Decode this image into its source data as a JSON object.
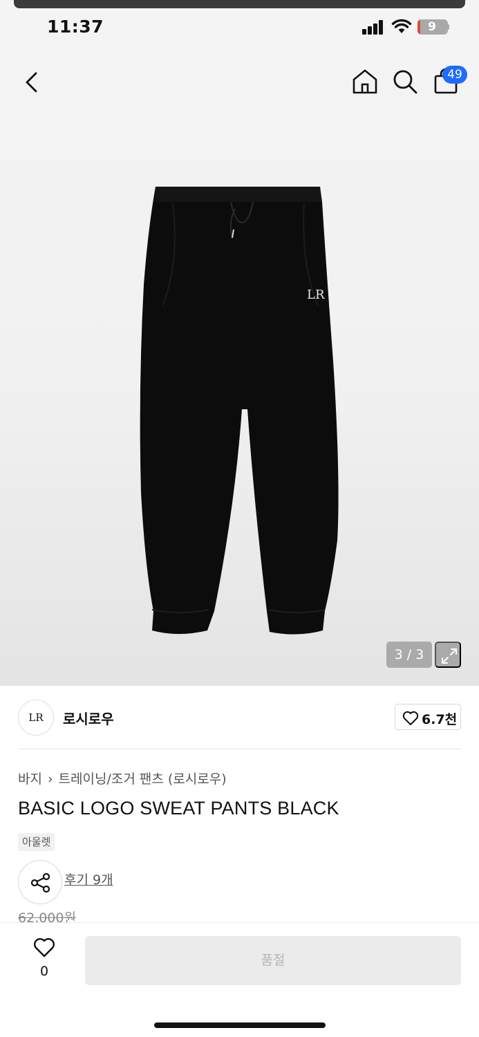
{
  "status_bar": {
    "time": "11:37",
    "battery": "9",
    "battery_level": 0.09
  },
  "nav": {
    "cart_count": "49"
  },
  "gallery": {
    "counter": "3 / 3",
    "logo_mark": "LR"
  },
  "brand": {
    "name": "로시로우",
    "logo": "LR",
    "likes": "6.7천"
  },
  "breadcrumb": {
    "category": "바지",
    "subcategory": "트레이닝/조거 팬츠 (로시로우)"
  },
  "product": {
    "title": "BASIC LOGO SWEAT PANTS BLACK",
    "tag": "아울렛",
    "reviews": "후기 9개",
    "original_price": "62,000원"
  },
  "bottom": {
    "wish_count": "0",
    "buy_label": "품절"
  },
  "colors": {
    "accent": "#1f6bff",
    "battery_low": "#e5463b"
  }
}
